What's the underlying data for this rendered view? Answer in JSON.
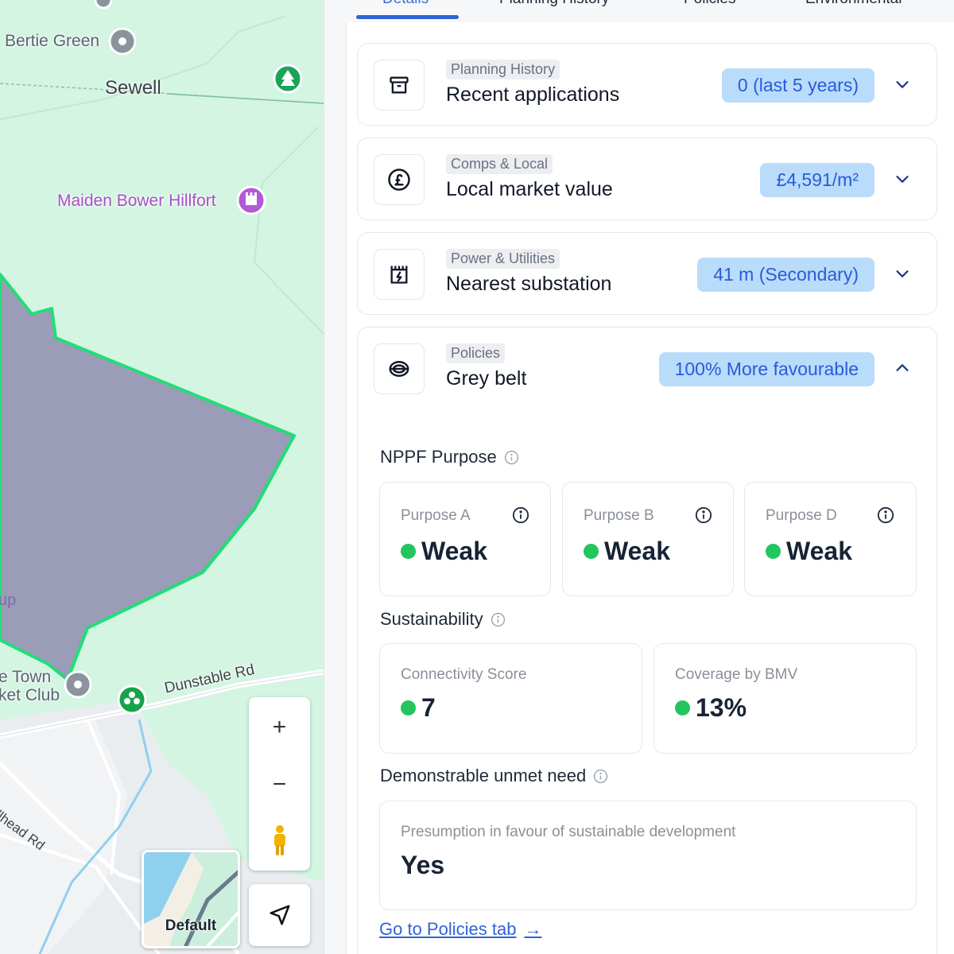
{
  "map": {
    "labels": {
      "bertie_green": "Bertie Green",
      "sewell": "Sewell",
      "maiden_bower": "Maiden Bower Hillfort",
      "partial_up": "up",
      "town_line1": "e Town",
      "town_line2": "ket Club",
      "dunstable_rd": "Dunstable Rd",
      "wellhead_rd": "ellhead Rd"
    },
    "controls": {
      "zoom_in": "+",
      "zoom_out": "−",
      "layer_label": "Default"
    },
    "colors": {
      "land": "#d3f5e2",
      "polygon_fill": "#9a9cb8",
      "polygon_stroke": "#22dd77",
      "poi_purple": "#b25ad8",
      "poi_green": "#16a34a"
    }
  },
  "tabs": [
    {
      "label": "Details",
      "active": true
    },
    {
      "label": "Planning History"
    },
    {
      "label": "Policies"
    },
    {
      "label": "Environmental"
    }
  ],
  "cards": [
    {
      "category": "Planning History",
      "title": "Recent applications",
      "badge": "0 (last 5 years)",
      "icon": "archive-box-icon",
      "expanded": false
    },
    {
      "category": "Comps & Local",
      "title": "Local market value",
      "badge": "£4,591/m²",
      "icon": "pound-circle-icon",
      "expanded": false
    },
    {
      "category": "Power & Utilities",
      "title": "Nearest substation",
      "badge": "41 m (Secondary)",
      "icon": "substation-icon",
      "expanded": false
    },
    {
      "category": "Policies",
      "title": "Grey belt",
      "badge": "100% More favourable",
      "icon": "grey-belt-icon",
      "expanded": true
    }
  ],
  "nppf": {
    "heading": "NPPF Purpose",
    "items": [
      {
        "label": "Purpose A",
        "value": "Weak"
      },
      {
        "label": "Purpose B",
        "value": "Weak"
      },
      {
        "label": "Purpose D",
        "value": "Weak"
      }
    ]
  },
  "sustainability": {
    "heading": "Sustainability",
    "items": [
      {
        "label": "Connectivity Score",
        "value": "7"
      },
      {
        "label": "Coverage by BMV",
        "value": "13%"
      }
    ]
  },
  "unmet_need": {
    "heading": "Demonstrable unmet need",
    "label": "Presumption in favour of sustainable development",
    "value": "Yes"
  },
  "link": {
    "label": "Go to Policies tab",
    "arrow": "→"
  },
  "colors": {
    "accent": "#2f63d6",
    "badge_bg": "#b9dcfb",
    "status_green": "#22c55e"
  }
}
